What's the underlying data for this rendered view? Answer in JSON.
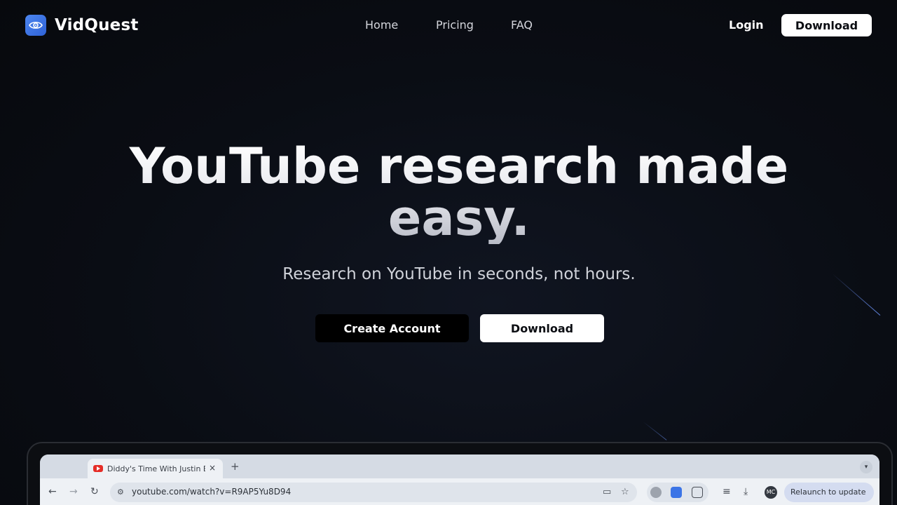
{
  "brand": {
    "name": "VidQuest",
    "logo_icon": "eye-icon",
    "logo_color": "#3b74e6"
  },
  "nav": {
    "links": [
      "Home",
      "Pricing",
      "FAQ"
    ],
    "login": "Login",
    "download": "Download"
  },
  "hero": {
    "title": "YouTube research made easy.",
    "subtitle": "Research on YouTube in seconds, not hours.",
    "create_account": "Create Account",
    "download": "Download"
  },
  "browser_mockup": {
    "tab_title": "Diddy's Time With Justin Bieber",
    "tab_close": "×",
    "new_tab": "+",
    "url": "youtube.com/watch?v=R9AP5Yu8D94",
    "avatar_initials": "MC",
    "relaunch": "Relaunch to update ⋮"
  }
}
